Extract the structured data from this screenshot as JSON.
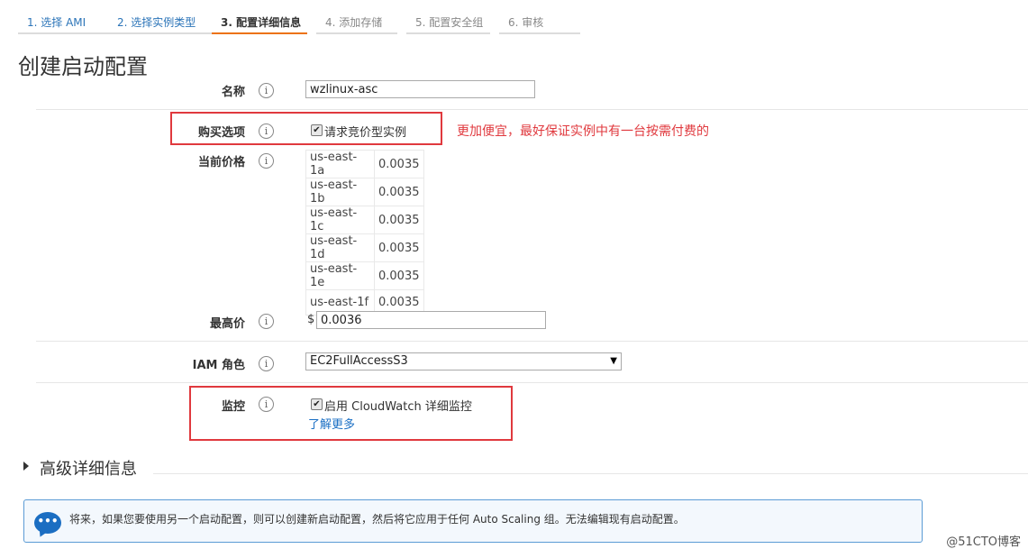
{
  "tabs": [
    {
      "label": "1. 选择 AMI",
      "state": "link"
    },
    {
      "label": "2. 选择实例类型",
      "state": "link"
    },
    {
      "label": "3. 配置详细信息",
      "state": "active"
    },
    {
      "label": "4. 添加存储",
      "state": "disabled"
    },
    {
      "label": "5. 配置安全组",
      "state": "disabled"
    },
    {
      "label": "6. 审核",
      "state": "disabled"
    }
  ],
  "page_title": "创建启动配置",
  "form": {
    "name": {
      "label": "名称",
      "value": "wzlinux-asc"
    },
    "purchase": {
      "label": "购买选项",
      "checkbox_label": "请求竞价型实例",
      "checked": true
    },
    "current_price": {
      "label": "当前价格",
      "rows": [
        {
          "zone": "us-east-1a",
          "price": "0.0035"
        },
        {
          "zone": "us-east-1b",
          "price": "0.0035"
        },
        {
          "zone": "us-east-1c",
          "price": "0.0035"
        },
        {
          "zone": "us-east-1d",
          "price": "0.0035"
        },
        {
          "zone": "us-east-1e",
          "price": "0.0035"
        },
        {
          "zone": "us-east-1f",
          "price": "0.0035"
        }
      ]
    },
    "max_price": {
      "label": "最高价",
      "currency": "$",
      "value": "0.0036"
    },
    "iam_role": {
      "label": "IAM 角色",
      "value": "EC2FullAccessS3"
    },
    "monitoring": {
      "label": "监控",
      "checkbox_label": "启用 CloudWatch 详细监控",
      "checked": true,
      "link": "了解更多"
    }
  },
  "annotation": "更加便宜，最好保证实例中有一台按需付费的",
  "advanced": {
    "title": "高级详细信息"
  },
  "info_box": {
    "text": "将来，如果您要使用另一个启动配置，则可以创建新启动配置，然后将它应用于任何 Auto Scaling 组。无法编辑现有启动配置。"
  },
  "watermark": "@51CTO博客",
  "icons": {
    "info": "info-icon",
    "chat": "chat-bubble-icon",
    "check": "checkmark-icon",
    "caret": "caret-right-icon",
    "dropdown": "dropdown-arrow-icon"
  },
  "colors": {
    "accent": "#ec7211",
    "link": "#2b74b8",
    "annotation": "#e0393e",
    "info_border": "#5b9bd5"
  }
}
